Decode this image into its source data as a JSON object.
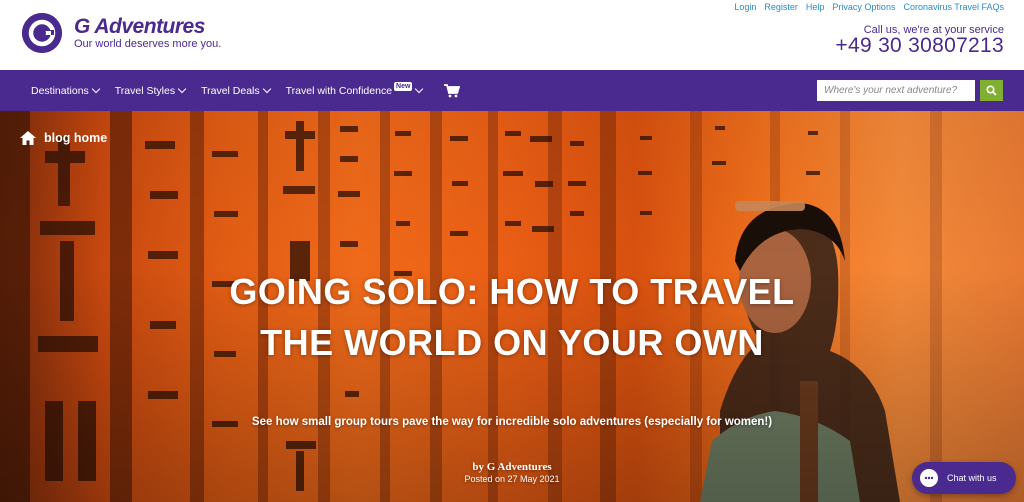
{
  "brand": {
    "name": "G Adventures",
    "tagline": "Our world deserves more you."
  },
  "utility_links": [
    "Login",
    "Register",
    "Help",
    "Privacy Options",
    "Coronavirus Travel FAQs"
  ],
  "contact": {
    "label": "Call us, we're at your service",
    "phone": "+49 30 30807213"
  },
  "nav": {
    "items": [
      "Destinations",
      "Travel Styles",
      "Travel Deals",
      "Travel with Confidence"
    ],
    "new_badge": "New",
    "cart_icon": "cart-icon"
  },
  "search": {
    "placeholder": "Where's your next adventure?",
    "icon": "search-icon"
  },
  "hero": {
    "blog_home": "blog home",
    "title": "Going Solo: How to Travel the World on Your Own",
    "subtitle": "See how small group tours pave the way for incredible solo adventures (especially for women!)",
    "byline": "by G Adventures",
    "posted": "Posted on 27 May 2021"
  },
  "chat": {
    "label": "Chat with us"
  },
  "colors": {
    "brand_purple": "#4b2a8f",
    "link_blue": "#2a8bc9",
    "search_green": "#7fb031",
    "hero_orange": "#f06a1a"
  }
}
